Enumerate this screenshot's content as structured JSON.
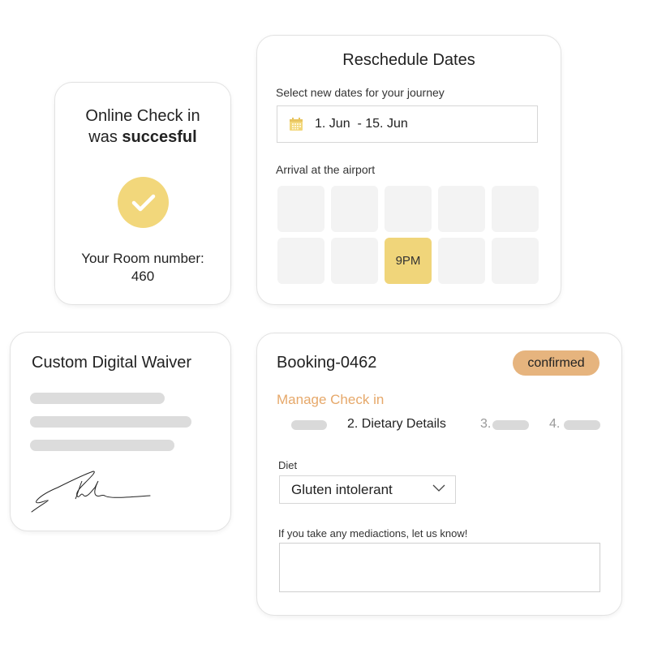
{
  "colors": {
    "accent_yellow": "#f2d77b",
    "badge_orange": "#e6b47e",
    "link_orange": "#e6a86a",
    "slot_gray": "#f3f3f3",
    "placeholder_gray": "#dcdcdc"
  },
  "checkin_card": {
    "title_line1": "Online Check in",
    "title_line2_prefix": "was ",
    "title_line2_bold": "succesful",
    "icon": "check-circle-icon",
    "room_label": "Your Room number:",
    "room_number": "460"
  },
  "reschedule_card": {
    "title": "Reschedule Dates",
    "dates_label": "Select new dates for your journey",
    "date_icon": "calendar-icon",
    "date_range": "1. Jun  - 15. Jun",
    "arrival_label": "Arrival at the airport",
    "time_slots": [
      {
        "label": "",
        "selected": false
      },
      {
        "label": "",
        "selected": false
      },
      {
        "label": "",
        "selected": false
      },
      {
        "label": "",
        "selected": false
      },
      {
        "label": "",
        "selected": false
      },
      {
        "label": "",
        "selected": false
      },
      {
        "label": "",
        "selected": false
      },
      {
        "label": "9PM",
        "selected": true
      },
      {
        "label": "",
        "selected": false
      },
      {
        "label": "",
        "selected": false
      }
    ]
  },
  "waiver_card": {
    "title": "Custom Digital Waiver",
    "signature_icon": "signature-icon"
  },
  "booking_card": {
    "booking_id": "Booking-0462",
    "status_badge": "confirmed",
    "section_title": "Manage Check in",
    "steps": [
      {
        "number": "",
        "label": "",
        "active": false
      },
      {
        "number": "2.",
        "label": "Dietary Details",
        "active": true
      },
      {
        "number": "3.",
        "label": "",
        "active": false
      },
      {
        "number": "4.",
        "label": "",
        "active": false
      }
    ],
    "step2_text": "2. Dietary Details",
    "step3_prefix": "3.",
    "step4_prefix": "4.",
    "diet_label": "Diet",
    "diet_value": "Gluten intolerant",
    "medications_label": "If you take any mediactions, let us know!",
    "medications_value": ""
  }
}
